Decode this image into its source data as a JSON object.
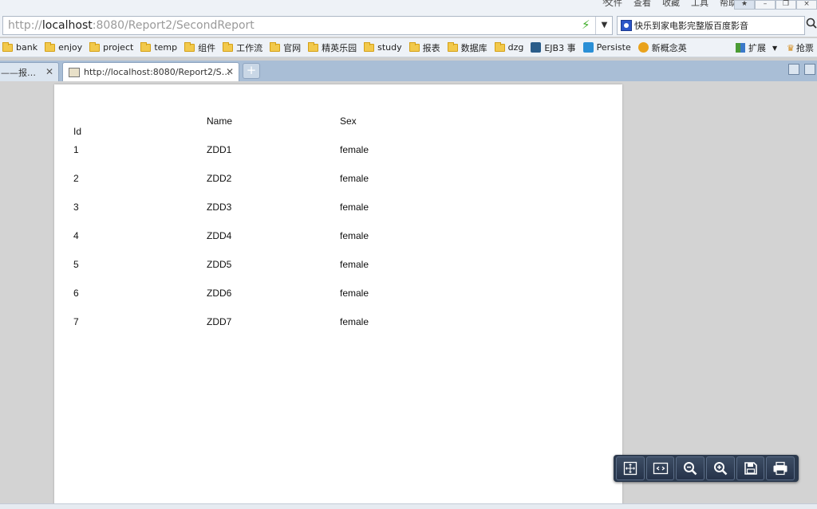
{
  "menubar": {
    "overflow": "»",
    "menus": [
      "文件",
      "查看",
      "收藏",
      "工具",
      "帮助"
    ]
  },
  "address": {
    "url": "http://localhost:8080/Report2/SecondReport",
    "url_prefix": "http://",
    "url_host": "localhost",
    "url_rest": ":8080/Report2/SecondReport"
  },
  "search": {
    "value": "快乐到家电影完整版百度影音"
  },
  "bookmarks": [
    {
      "label": "bank",
      "icon": "folder-icon"
    },
    {
      "label": "enjoy",
      "icon": "folder-icon"
    },
    {
      "label": "project",
      "icon": "folder-icon"
    },
    {
      "label": "temp",
      "icon": "folder-icon"
    },
    {
      "label": "组件",
      "icon": "folder-icon"
    },
    {
      "label": "工作流",
      "icon": "folder-icon"
    },
    {
      "label": "官网",
      "icon": "folder-icon"
    },
    {
      "label": "精英乐园",
      "icon": "folder-icon"
    },
    {
      "label": "study",
      "icon": "folder-icon"
    },
    {
      "label": "报表",
      "icon": "folder-icon"
    },
    {
      "label": "数据库",
      "icon": "folder-icon"
    },
    {
      "label": "dzg",
      "icon": "folder-icon"
    },
    {
      "label": "EJB3 事",
      "icon": "site-icon"
    },
    {
      "label": "Persiste",
      "icon": "site-icon"
    },
    {
      "label": "新概念英",
      "icon": "site-icon"
    }
  ],
  "bookmarks_right": {
    "extensions": "扩展",
    "ticket": "抢票"
  },
  "tabs": [
    {
      "label": "——报…",
      "active": false
    },
    {
      "label": "http://localhost:8080/Report2/S…",
      "active": true
    }
  ],
  "newtab_label": "+",
  "report": {
    "headers": {
      "id": "Id",
      "name": "Name",
      "sex": "Sex"
    },
    "rows": [
      {
        "id": "1",
        "name": "ZDD1",
        "sex": "female"
      },
      {
        "id": "2",
        "name": "ZDD2",
        "sex": "female"
      },
      {
        "id": "3",
        "name": "ZDD3",
        "sex": "female"
      },
      {
        "id": "4",
        "name": "ZDD4",
        "sex": "female"
      },
      {
        "id": "5",
        "name": "ZDD5",
        "sex": "female"
      },
      {
        "id": "6",
        "name": "ZDD6",
        "sex": "female"
      },
      {
        "id": "7",
        "name": "ZDD7",
        "sex": "female"
      }
    ]
  },
  "report_toolbar": [
    "fit-page-icon",
    "fit-width-icon",
    "zoom-out-icon",
    "zoom-in-icon",
    "save-icon",
    "print-icon"
  ],
  "colors": {
    "tabbar": "#a9bed6",
    "toolbar": "#2c3a4e",
    "folder": "#f2c94c",
    "bolt": "#3fae2a"
  }
}
